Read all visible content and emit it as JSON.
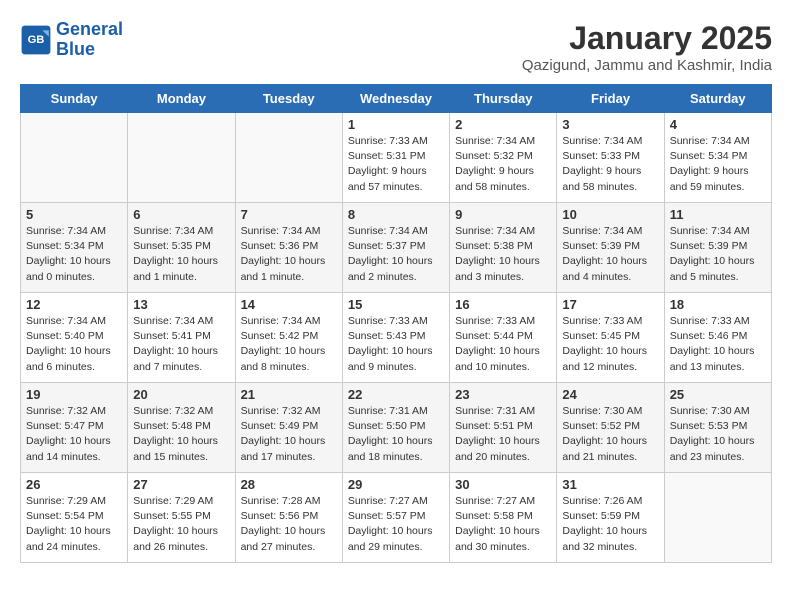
{
  "logo": {
    "line1": "General",
    "line2": "Blue"
  },
  "title": "January 2025",
  "subtitle": "Qazigund, Jammu and Kashmir, India",
  "headers": [
    "Sunday",
    "Monday",
    "Tuesday",
    "Wednesday",
    "Thursday",
    "Friday",
    "Saturday"
  ],
  "weeks": [
    [
      {
        "day": "",
        "info": ""
      },
      {
        "day": "",
        "info": ""
      },
      {
        "day": "",
        "info": ""
      },
      {
        "day": "1",
        "info": "Sunrise: 7:33 AM\nSunset: 5:31 PM\nDaylight: 9 hours\nand 57 minutes."
      },
      {
        "day": "2",
        "info": "Sunrise: 7:34 AM\nSunset: 5:32 PM\nDaylight: 9 hours\nand 58 minutes."
      },
      {
        "day": "3",
        "info": "Sunrise: 7:34 AM\nSunset: 5:33 PM\nDaylight: 9 hours\nand 58 minutes."
      },
      {
        "day": "4",
        "info": "Sunrise: 7:34 AM\nSunset: 5:34 PM\nDaylight: 9 hours\nand 59 minutes."
      }
    ],
    [
      {
        "day": "5",
        "info": "Sunrise: 7:34 AM\nSunset: 5:34 PM\nDaylight: 10 hours\nand 0 minutes."
      },
      {
        "day": "6",
        "info": "Sunrise: 7:34 AM\nSunset: 5:35 PM\nDaylight: 10 hours\nand 1 minute."
      },
      {
        "day": "7",
        "info": "Sunrise: 7:34 AM\nSunset: 5:36 PM\nDaylight: 10 hours\nand 1 minute."
      },
      {
        "day": "8",
        "info": "Sunrise: 7:34 AM\nSunset: 5:37 PM\nDaylight: 10 hours\nand 2 minutes."
      },
      {
        "day": "9",
        "info": "Sunrise: 7:34 AM\nSunset: 5:38 PM\nDaylight: 10 hours\nand 3 minutes."
      },
      {
        "day": "10",
        "info": "Sunrise: 7:34 AM\nSunset: 5:39 PM\nDaylight: 10 hours\nand 4 minutes."
      },
      {
        "day": "11",
        "info": "Sunrise: 7:34 AM\nSunset: 5:39 PM\nDaylight: 10 hours\nand 5 minutes."
      }
    ],
    [
      {
        "day": "12",
        "info": "Sunrise: 7:34 AM\nSunset: 5:40 PM\nDaylight: 10 hours\nand 6 minutes."
      },
      {
        "day": "13",
        "info": "Sunrise: 7:34 AM\nSunset: 5:41 PM\nDaylight: 10 hours\nand 7 minutes."
      },
      {
        "day": "14",
        "info": "Sunrise: 7:34 AM\nSunset: 5:42 PM\nDaylight: 10 hours\nand 8 minutes."
      },
      {
        "day": "15",
        "info": "Sunrise: 7:33 AM\nSunset: 5:43 PM\nDaylight: 10 hours\nand 9 minutes."
      },
      {
        "day": "16",
        "info": "Sunrise: 7:33 AM\nSunset: 5:44 PM\nDaylight: 10 hours\nand 10 minutes."
      },
      {
        "day": "17",
        "info": "Sunrise: 7:33 AM\nSunset: 5:45 PM\nDaylight: 10 hours\nand 12 minutes."
      },
      {
        "day": "18",
        "info": "Sunrise: 7:33 AM\nSunset: 5:46 PM\nDaylight: 10 hours\nand 13 minutes."
      }
    ],
    [
      {
        "day": "19",
        "info": "Sunrise: 7:32 AM\nSunset: 5:47 PM\nDaylight: 10 hours\nand 14 minutes."
      },
      {
        "day": "20",
        "info": "Sunrise: 7:32 AM\nSunset: 5:48 PM\nDaylight: 10 hours\nand 15 minutes."
      },
      {
        "day": "21",
        "info": "Sunrise: 7:32 AM\nSunset: 5:49 PM\nDaylight: 10 hours\nand 17 minutes."
      },
      {
        "day": "22",
        "info": "Sunrise: 7:31 AM\nSunset: 5:50 PM\nDaylight: 10 hours\nand 18 minutes."
      },
      {
        "day": "23",
        "info": "Sunrise: 7:31 AM\nSunset: 5:51 PM\nDaylight: 10 hours\nand 20 minutes."
      },
      {
        "day": "24",
        "info": "Sunrise: 7:30 AM\nSunset: 5:52 PM\nDaylight: 10 hours\nand 21 minutes."
      },
      {
        "day": "25",
        "info": "Sunrise: 7:30 AM\nSunset: 5:53 PM\nDaylight: 10 hours\nand 23 minutes."
      }
    ],
    [
      {
        "day": "26",
        "info": "Sunrise: 7:29 AM\nSunset: 5:54 PM\nDaylight: 10 hours\nand 24 minutes."
      },
      {
        "day": "27",
        "info": "Sunrise: 7:29 AM\nSunset: 5:55 PM\nDaylight: 10 hours\nand 26 minutes."
      },
      {
        "day": "28",
        "info": "Sunrise: 7:28 AM\nSunset: 5:56 PM\nDaylight: 10 hours\nand 27 minutes."
      },
      {
        "day": "29",
        "info": "Sunrise: 7:27 AM\nSunset: 5:57 PM\nDaylight: 10 hours\nand 29 minutes."
      },
      {
        "day": "30",
        "info": "Sunrise: 7:27 AM\nSunset: 5:58 PM\nDaylight: 10 hours\nand 30 minutes."
      },
      {
        "day": "31",
        "info": "Sunrise: 7:26 AM\nSunset: 5:59 PM\nDaylight: 10 hours\nand 32 minutes."
      },
      {
        "day": "",
        "info": ""
      }
    ]
  ]
}
